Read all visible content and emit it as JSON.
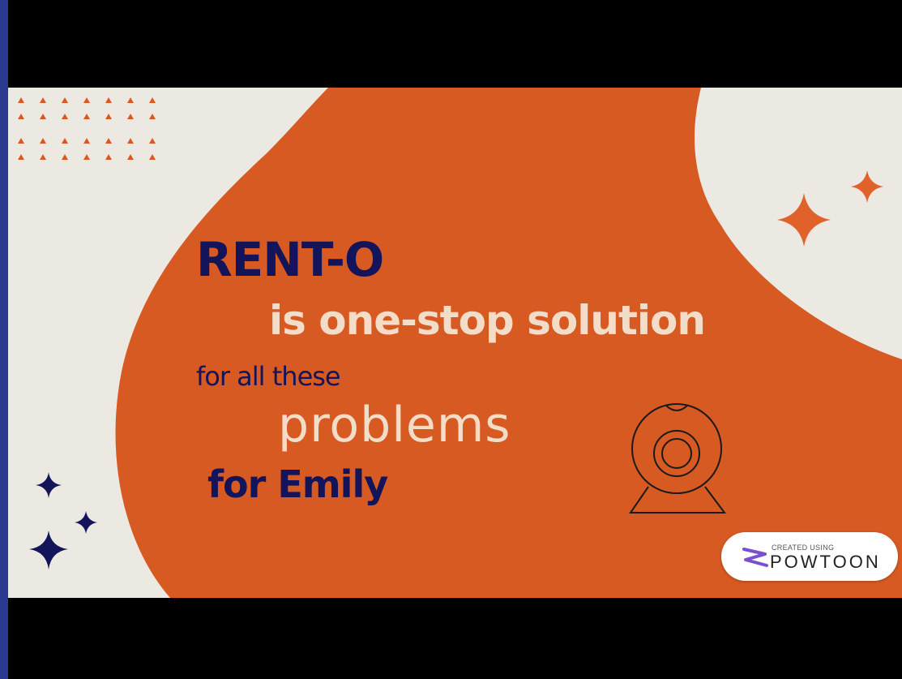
{
  "slide": {
    "title": "RENT-O",
    "line2": "is one-stop solution",
    "line3": "for all these",
    "line4": "problems",
    "line5": "for Emily"
  },
  "badge": {
    "small_text": "CREATED USING",
    "brand": "POWTOON"
  },
  "icons": [
    "webcam-icon",
    "sparkle-icon",
    "triangle-pattern-icon",
    "powtoon-logo-icon"
  ],
  "colors": {
    "page_border": "#2b3a8f",
    "letterbox": "#000000",
    "background": "#ece9e3",
    "blob_orange": "#d65a22",
    "navy_text": "#14145a",
    "cream_text": "#f3ddc9"
  }
}
